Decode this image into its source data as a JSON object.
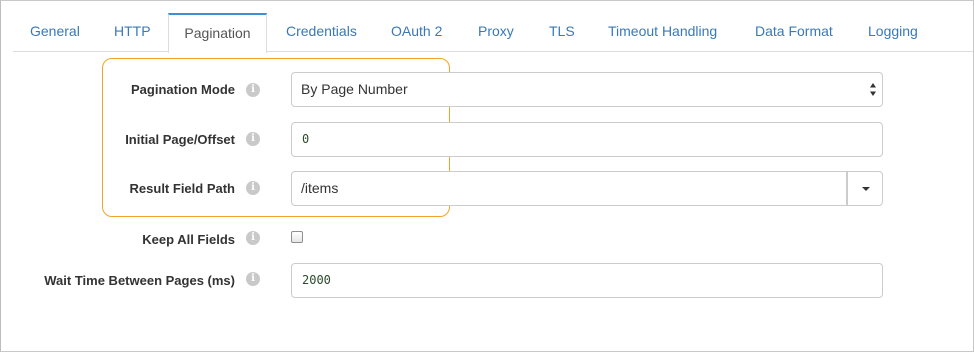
{
  "tabs": [
    {
      "label": "General",
      "active": false
    },
    {
      "label": "HTTP",
      "active": false
    },
    {
      "label": "Pagination",
      "active": true
    },
    {
      "label": "Credentials",
      "active": false
    },
    {
      "label": "OAuth 2",
      "active": false
    },
    {
      "label": "Proxy",
      "active": false
    },
    {
      "label": "TLS",
      "active": false
    },
    {
      "label": "Timeout Handling",
      "active": false
    },
    {
      "label": "Data Format",
      "active": false
    },
    {
      "label": "Logging",
      "active": false
    }
  ],
  "form": {
    "pagination_mode": {
      "label": "Pagination Mode",
      "value": "By Page Number"
    },
    "initial_page": {
      "label": "Initial Page/Offset",
      "value": "0"
    },
    "result_field_path": {
      "label": "Result Field Path",
      "value": "/items"
    },
    "keep_all_fields": {
      "label": "Keep All Fields",
      "checked": false
    },
    "wait_time": {
      "label": "Wait Time Between Pages (ms)",
      "value": "2000"
    }
  },
  "info_icon_glyph": "i",
  "colors": {
    "tab_link": "#3a78b8",
    "active_tab_top": "#3e8fd6",
    "highlight": "#f0a32b"
  }
}
